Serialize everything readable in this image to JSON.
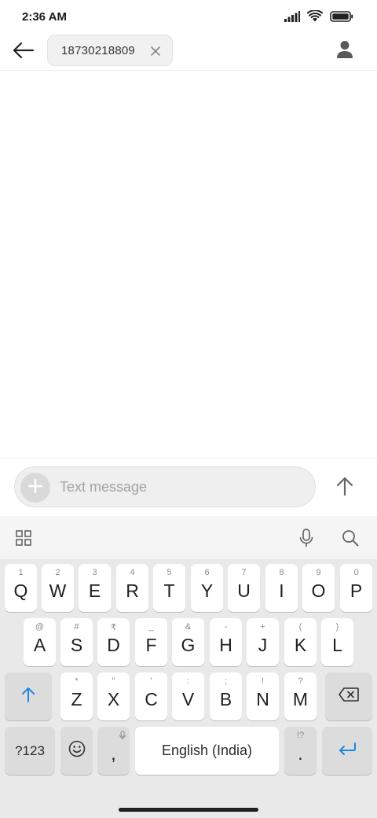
{
  "status_bar": {
    "time": "2:36 AM",
    "icons": [
      "signal-icon",
      "wifi-icon",
      "battery-icon"
    ]
  },
  "header": {
    "back_icon": "arrow-left-icon",
    "recipient": "18730218809",
    "clear_icon": "close-icon",
    "contact_icon": "person-icon"
  },
  "composer": {
    "attach_icon": "plus-icon",
    "placeholder": "Text message",
    "value": "",
    "send_icon": "arrow-up-icon"
  },
  "keyboard_toolbar": {
    "left_icon": "grid-icon",
    "right_icons": [
      "microphone-icon",
      "search-icon"
    ]
  },
  "keyboard": {
    "row1": [
      {
        "main": "Q",
        "hint": "1"
      },
      {
        "main": "W",
        "hint": "2"
      },
      {
        "main": "E",
        "hint": "3"
      },
      {
        "main": "R",
        "hint": "4"
      },
      {
        "main": "T",
        "hint": "5"
      },
      {
        "main": "Y",
        "hint": "6"
      },
      {
        "main": "U",
        "hint": "7"
      },
      {
        "main": "I",
        "hint": "8"
      },
      {
        "main": "O",
        "hint": "9"
      },
      {
        "main": "P",
        "hint": "0"
      }
    ],
    "row2": [
      {
        "main": "A",
        "hint": "@"
      },
      {
        "main": "S",
        "hint": "#"
      },
      {
        "main": "D",
        "hint": "₹"
      },
      {
        "main": "F",
        "hint": "_"
      },
      {
        "main": "G",
        "hint": "&"
      },
      {
        "main": "H",
        "hint": "-"
      },
      {
        "main": "J",
        "hint": "+"
      },
      {
        "main": "K",
        "hint": "("
      },
      {
        "main": "L",
        "hint": ")"
      }
    ],
    "row3": [
      {
        "main": "Z",
        "hint": "*"
      },
      {
        "main": "X",
        "hint": "\""
      },
      {
        "main": "C",
        "hint": "'"
      },
      {
        "main": "V",
        "hint": ":"
      },
      {
        "main": "B",
        "hint": ";"
      },
      {
        "main": "N",
        "hint": "!"
      },
      {
        "main": "M",
        "hint": "?"
      }
    ],
    "shift_icon": "shift-arrow-icon",
    "backspace_icon": "backspace-icon",
    "symbols_label": "?123",
    "emoji_icon": "emoji-icon",
    "comma_main": ",",
    "comma_hint_icon": "microphone-icon",
    "space_label": "English (India)",
    "period_main": ".",
    "period_hint": "!?",
    "enter_icon": "enter-icon"
  },
  "colors": {
    "accent": "#1e88e5",
    "keyboard_bg": "#e9e9e9",
    "key_bg": "#ffffff",
    "function_key_bg": "#dcdcdc"
  }
}
